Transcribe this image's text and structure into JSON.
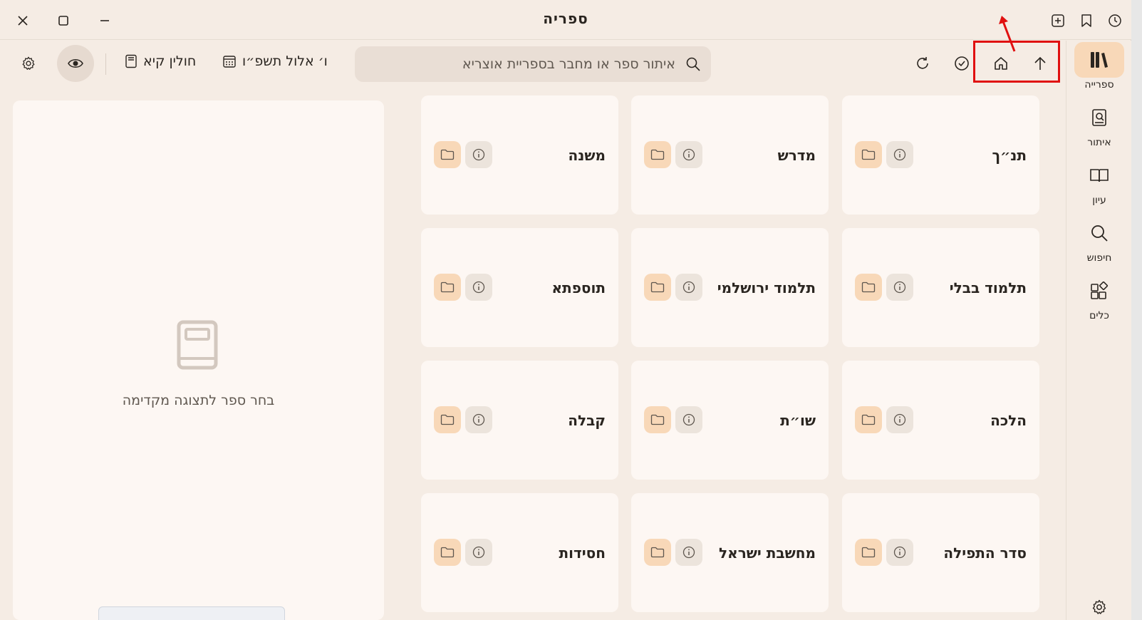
{
  "window": {
    "title": "ספריה"
  },
  "toolbar": {
    "search_placeholder": "איתור ספר או מחבר בספריית אוצריא",
    "hebrew_date": "ו׳ אלול תשפ״ו",
    "daily_page": "חולין קיא"
  },
  "sidebar": {
    "items": [
      {
        "label": "ספרייה",
        "icon": "library-icon",
        "active": true
      },
      {
        "label": "איתור",
        "icon": "find-book-icon",
        "active": false
      },
      {
        "label": "עיון",
        "icon": "open-book-icon",
        "active": false
      },
      {
        "label": "חיפוש",
        "icon": "search-icon",
        "active": false
      },
      {
        "label": "כלים",
        "icon": "tools-icon",
        "active": false
      }
    ]
  },
  "preview": {
    "empty_message": "בחר ספר לתצוגה מקדימה"
  },
  "categories": [
    {
      "label": "תנ״ך"
    },
    {
      "label": "מדרש"
    },
    {
      "label": "משנה"
    },
    {
      "label": "תלמוד בבלי"
    },
    {
      "label": "תלמוד ירושלמי"
    },
    {
      "label": "תוספתא"
    },
    {
      "label": "הלכה"
    },
    {
      "label": "שו״ת"
    },
    {
      "label": "קבלה"
    },
    {
      "label": "סדר התפילה"
    },
    {
      "label": "מחשבת ישראל"
    },
    {
      "label": "חסידות"
    }
  ],
  "colors": {
    "background": "#f5ece4",
    "card": "#fdf7f3",
    "accent": "#f8d8b8",
    "highlight": "#e01010"
  }
}
